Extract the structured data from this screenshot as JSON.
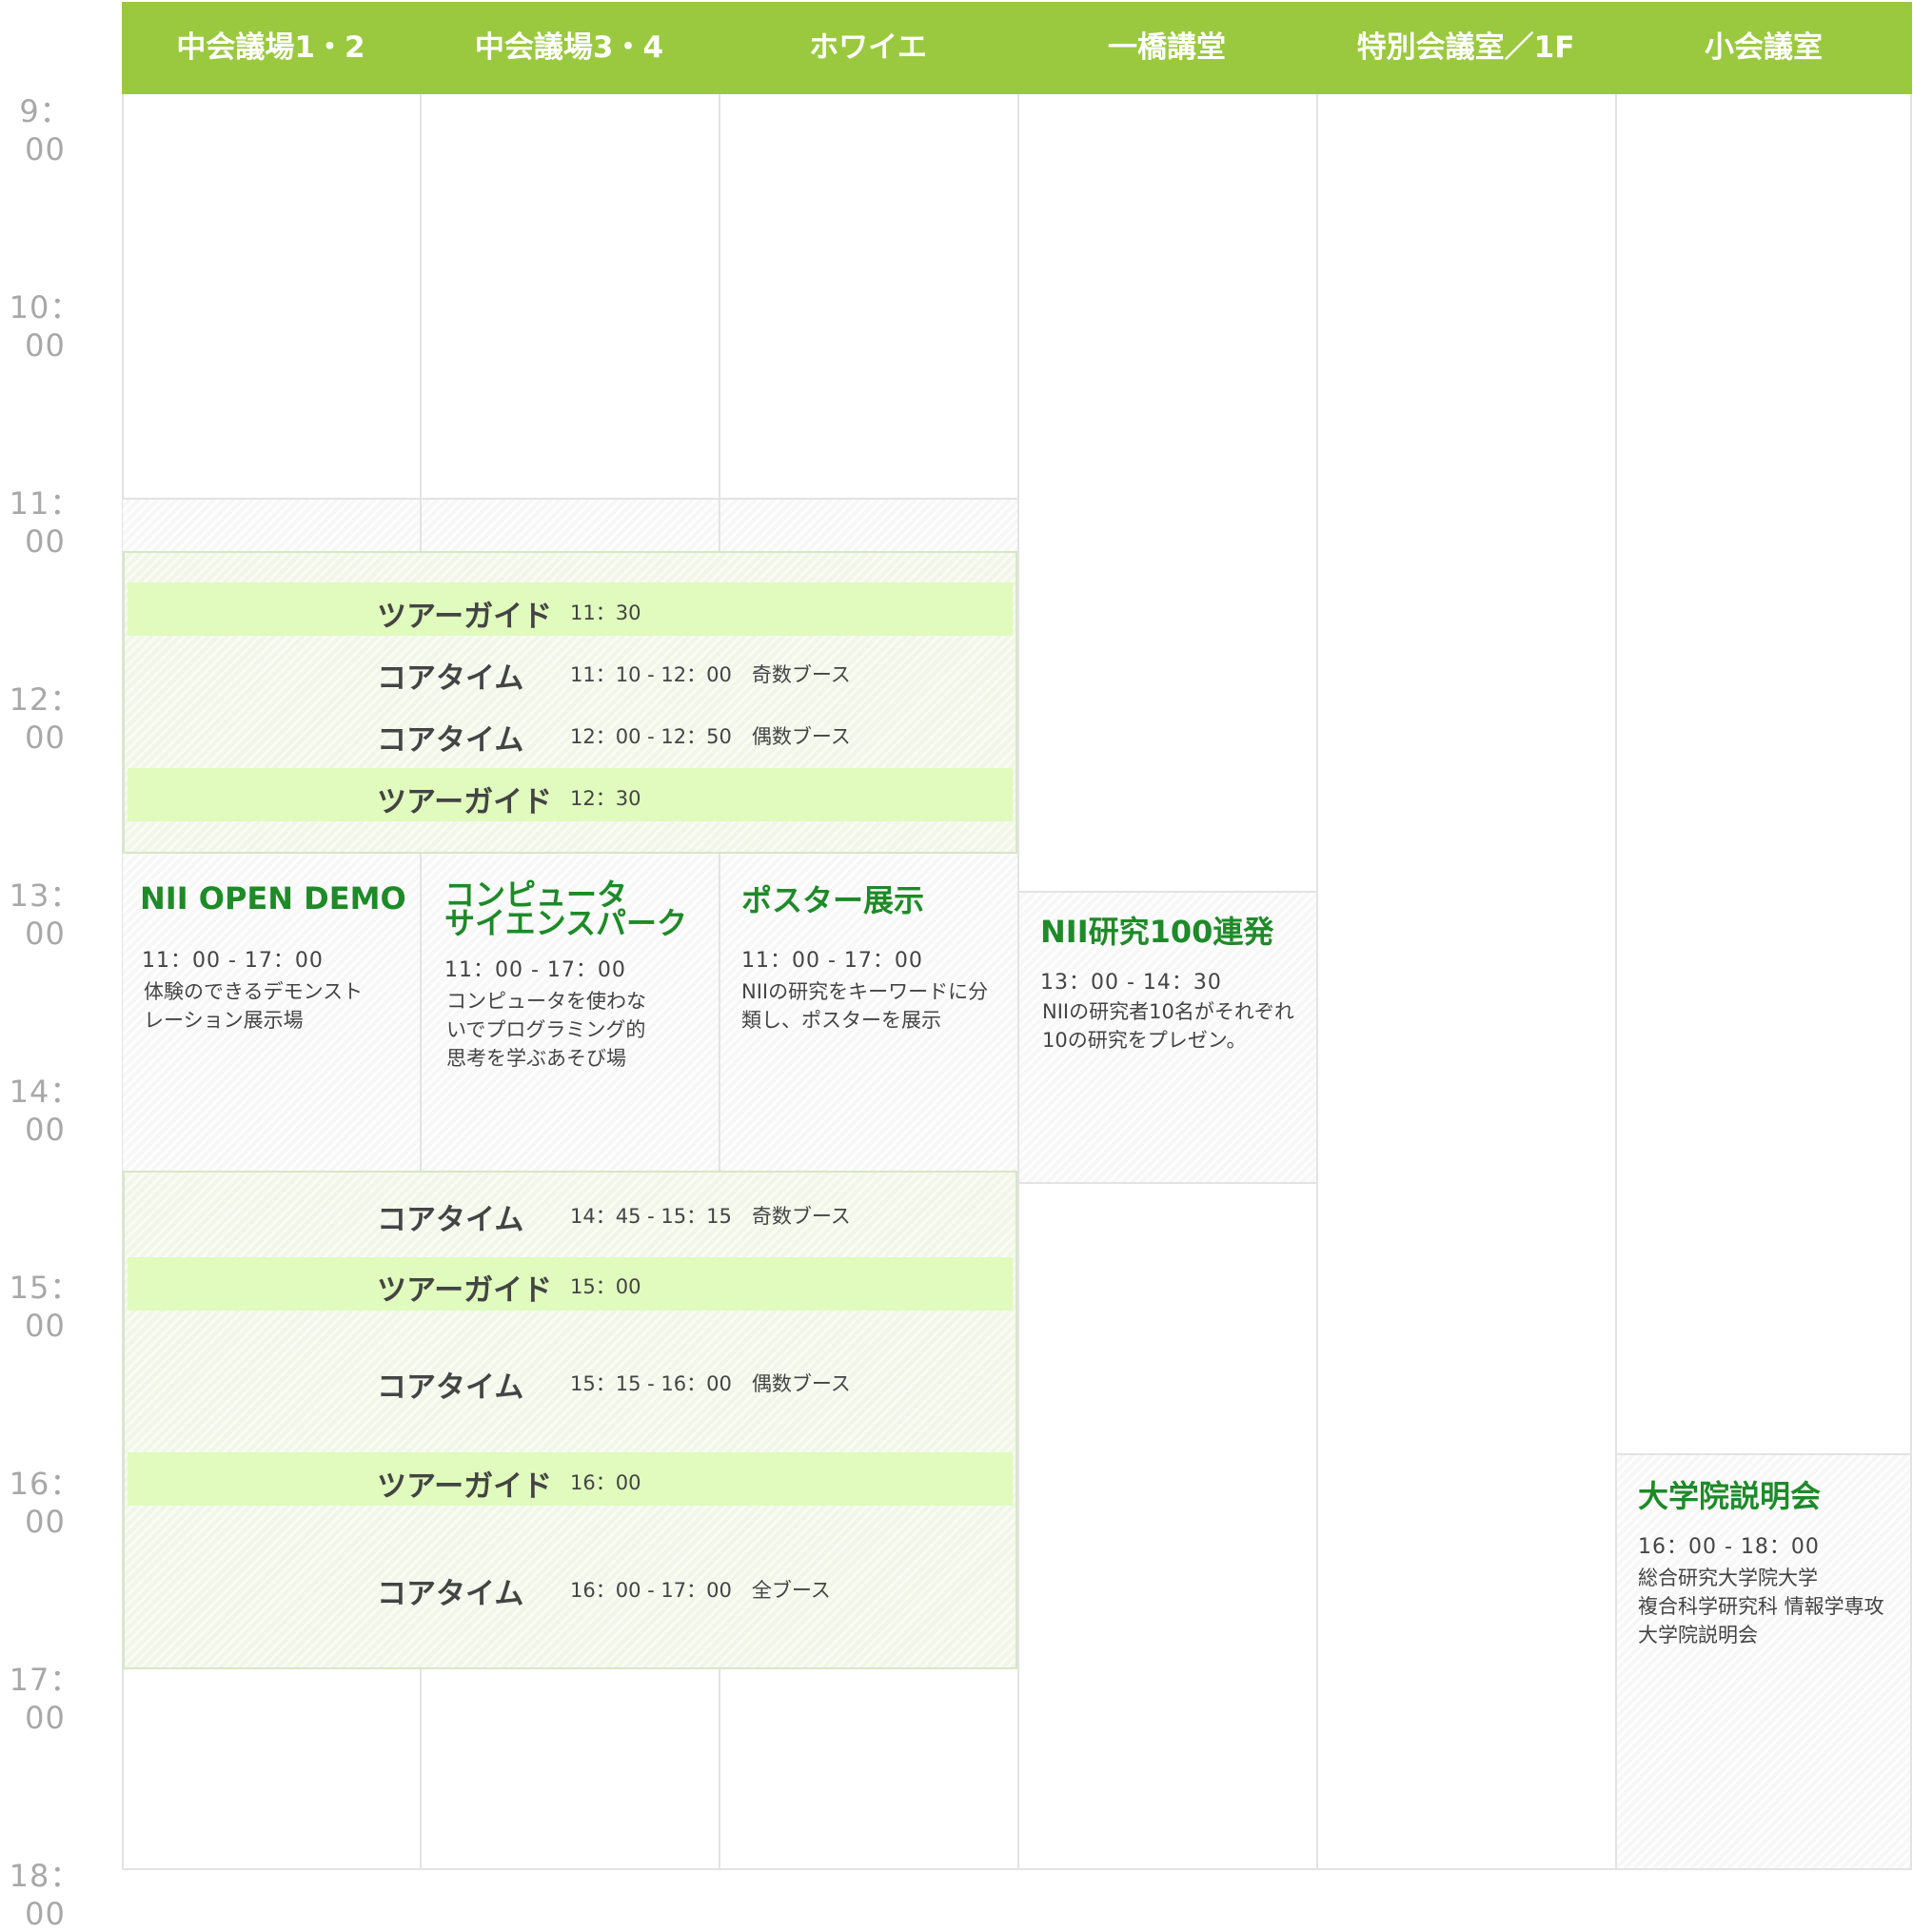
{
  "colors": {
    "header_green": "#9ac93f",
    "title_green": "#1e8a28",
    "tour_band": "#e0fbbd",
    "grid_line": "#e3e3e3",
    "time_text": "#a8a8a8"
  },
  "times": [
    "9：00",
    "10：00",
    "11：00",
    "12：00",
    "13：00",
    "14：00",
    "15：00",
    "16：00",
    "17：00",
    "18：00"
  ],
  "columns": [
    "中会議場1・2",
    "中会議場3・4",
    "ホワイエ",
    "一橋講堂",
    "特別会議室／1F",
    "小会議室"
  ],
  "core_block_1": {
    "rows": [
      {
        "type": "tour",
        "label": "ツアーガイド",
        "detail": "11：30"
      },
      {
        "type": "core",
        "label": "コアタイム",
        "detail": "11：10 - 12：00　奇数ブース"
      },
      {
        "type": "core",
        "label": "コアタイム",
        "detail": "12：00 - 12：50　偶数ブース"
      },
      {
        "type": "tour",
        "label": "ツアーガイド",
        "detail": "12：30"
      }
    ]
  },
  "core_block_2": {
    "rows": [
      {
        "type": "core",
        "label": "コアタイム",
        "detail": "14：45 - 15：15　奇数ブース"
      },
      {
        "type": "tour",
        "label": "ツアーガイド",
        "detail": "15：00"
      },
      {
        "type": "core",
        "label": "コアタイム",
        "detail": "15：15 - 16：00　偶数ブース"
      },
      {
        "type": "tour",
        "label": "ツアーガイド",
        "detail": "16：00"
      },
      {
        "type": "core",
        "label": "コアタイム",
        "detail": "16：00 - 17：00　全ブース"
      }
    ]
  },
  "events": {
    "open_demo": {
      "title": "NII OPEN DEMO",
      "time": "11：00 - 17：00",
      "desc_1": "体験のできるデモンスト",
      "desc_2": "レーション展示場"
    },
    "cs_park": {
      "title_1": "コンピュータ",
      "title_2": "サイエンスパーク",
      "time": "11：00 - 17：00",
      "desc_1": "コンピュータを使わな",
      "desc_2": "いでプログラミング的",
      "desc_3": "思考を学ぶあそび場"
    },
    "poster": {
      "title": "ポスター展示",
      "time": "11：00 - 17：00",
      "desc_1": "NIIの研究をキーワードに分",
      "desc_2": "類し、ポスターを展示"
    },
    "nii100": {
      "title": "NII研究100連発",
      "time": "13：00 - 14：30",
      "desc_1": "NIIの研究者10名がそれぞれ",
      "desc_2": "10の研究をプレゼン。"
    },
    "grad": {
      "title": "大学院説明会",
      "time": "16：00 - 18：00",
      "desc_1": "総合研究大学院大学",
      "desc_2": "複合科学研究科 情報学専攻",
      "desc_3": "大学院説明会"
    }
  }
}
